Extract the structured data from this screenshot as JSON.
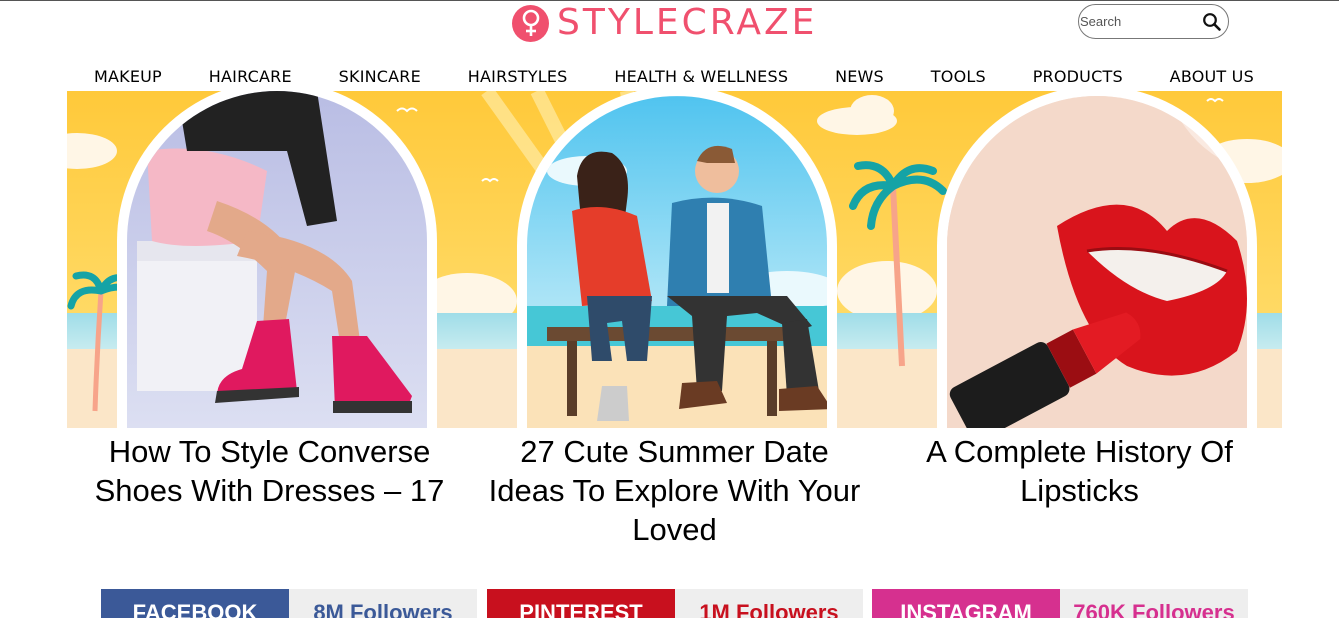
{
  "brand": {
    "name": "STYLECRAZE",
    "color": "#f0506e"
  },
  "search": {
    "placeholder": "Search"
  },
  "nav": [
    "MAKEUP",
    "HAIRCARE",
    "SKINCARE",
    "HAIRSTYLES",
    "HEALTH & WELLNESS",
    "NEWS",
    "TOOLS",
    "PRODUCTS",
    "ABOUT US"
  ],
  "articles": [
    {
      "title": "How To Style Converse Shoes With Dresses – 17"
    },
    {
      "title": "27 Cute Summer Date Ideas To Explore With Your Loved"
    },
    {
      "title": "A Complete History Of Lipsticks"
    }
  ],
  "social": [
    {
      "network": "FACEBOOK",
      "followers": "8M Followers",
      "color": "#3b5998",
      "text_color": "#3b5998"
    },
    {
      "network": "PINTEREST",
      "followers": "1M Followers",
      "color": "#c8101e",
      "text_color": "#c8101e"
    },
    {
      "network": "INSTAGRAM",
      "followers": "760K Followers",
      "color": "#d6308f",
      "text_color": "#d6308f"
    }
  ]
}
